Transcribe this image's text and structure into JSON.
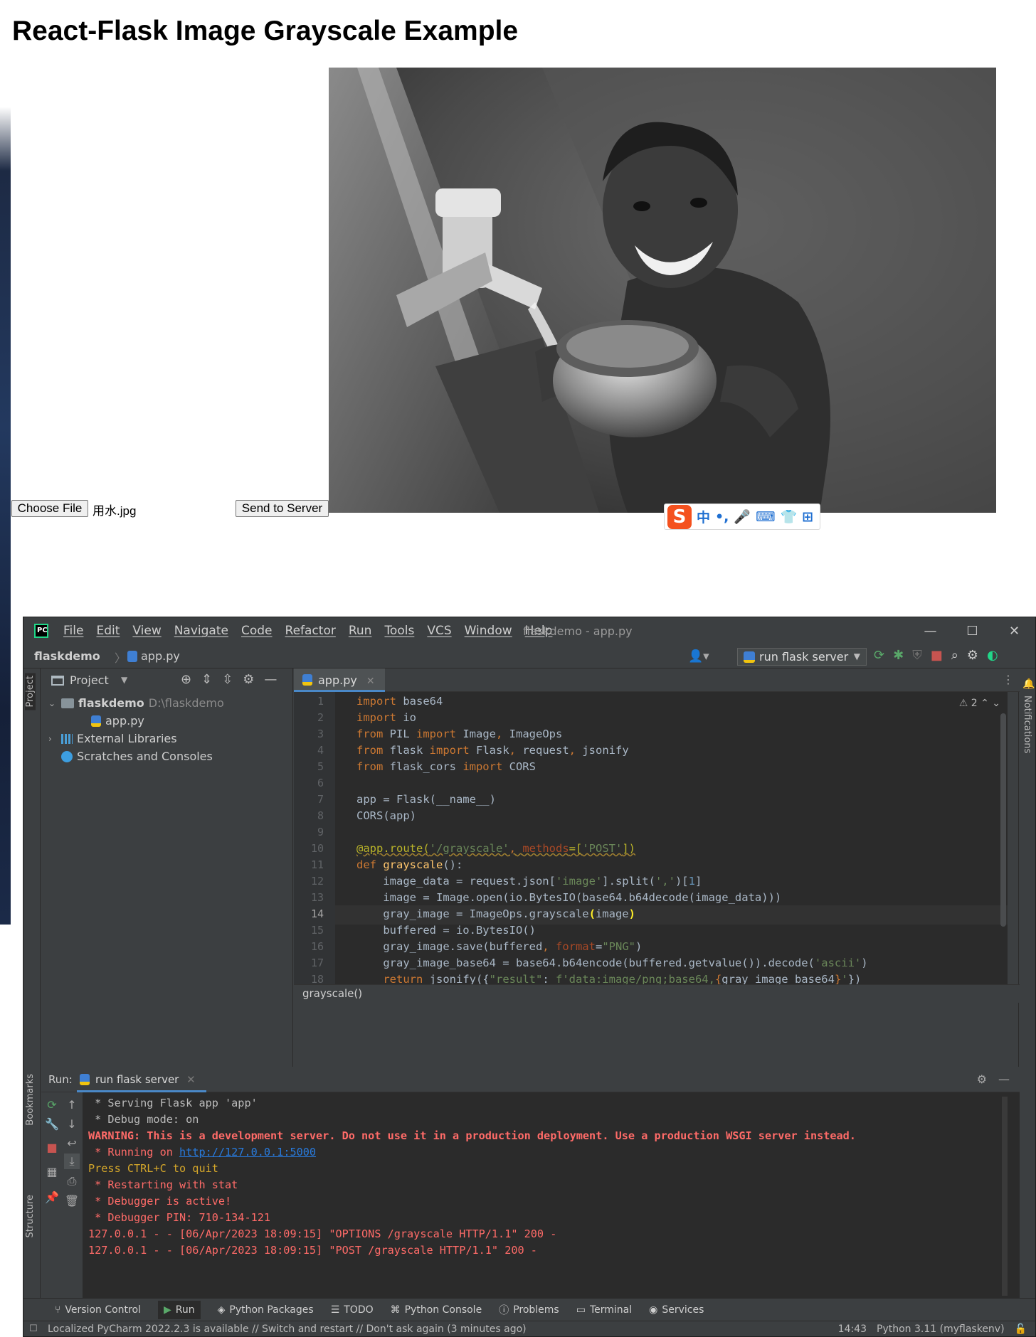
{
  "page": {
    "title": "React-Flask Image Grayscale Example",
    "choose_file_label": "Choose File",
    "file_name": "用水.jpg",
    "send_label": "Send to Server",
    "image_alt": "grayscale photo of boy drinking from a tap"
  },
  "ime": {
    "logo": "S",
    "items": [
      "中",
      "•,",
      "🎤",
      "⌨",
      "👕",
      "⊞"
    ]
  },
  "ide": {
    "menu": [
      "File",
      "Edit",
      "View",
      "Navigate",
      "Code",
      "Refactor",
      "Run",
      "Tools",
      "VCS",
      "Window",
      "Help"
    ],
    "window_title": "flaskdemo - app.py",
    "window_controls": [
      "—",
      "☐",
      "✕"
    ],
    "breadcrumb_root": "flaskdemo",
    "breadcrumb_file": "app.py",
    "run_config": "run flask server",
    "left_stripe": {
      "project": "Project",
      "bookmarks": "Bookmarks",
      "structure": "Structure"
    },
    "right_stripe": {
      "notifications": "Notifications"
    },
    "project_panel": {
      "title": "Project",
      "tree": {
        "root_name": "flaskdemo",
        "root_path": "D:\\flaskdemo",
        "file": "app.py",
        "external": "External Libraries",
        "scratches": "Scratches and Consoles"
      }
    },
    "editor": {
      "tab": "app.py",
      "inspections": "2",
      "current_line": 14,
      "line_numbers": [
        "1",
        "2",
        "3",
        "4",
        "5",
        "6",
        "7",
        "8",
        "9",
        "10",
        "11",
        "12",
        "13",
        "14",
        "15",
        "16",
        "17",
        "18"
      ],
      "breadcrumb": "grayscale()"
    },
    "run": {
      "label": "Run:",
      "tab": "run flask server",
      "console": {
        "l1": " * Serving Flask app 'app'",
        "l2": " * Debug mode: on",
        "l3": "WARNING: This is a development server. Do not use it in a production deployment. Use a production WSGI server instead.",
        "l4_prefix": " * Running on ",
        "l4_link": "http://127.0.0.1:5000",
        "l5": "Press CTRL+C to quit",
        "l6": " * Restarting with stat",
        "l7": " * Debugger is active!",
        "l8": " * Debugger PIN: 710-134-121",
        "l9": "127.0.0.1 - - [06/Apr/2023 18:09:15] \"OPTIONS /grayscale HTTP/1.1\" 200 -",
        "l10": "127.0.0.1 - - [06/Apr/2023 18:09:15] \"POST /grayscale HTTP/1.1\" 200 -"
      }
    },
    "bottom_tools": [
      "Version Control",
      "Run",
      "Python Packages",
      "TODO",
      "Python Console",
      "Problems",
      "Terminal",
      "Services"
    ],
    "status": {
      "message": "Localized PyCharm 2022.2.3 is available // Switch and restart // Don't ask again (3 minutes ago)",
      "time": "14:43",
      "interpreter": "Python 3.11 (myflaskenv)"
    },
    "colors": {
      "accent": "#4a88c7",
      "keyword": "#cc7832",
      "string": "#6a8759",
      "error": "#ff6b68"
    }
  }
}
